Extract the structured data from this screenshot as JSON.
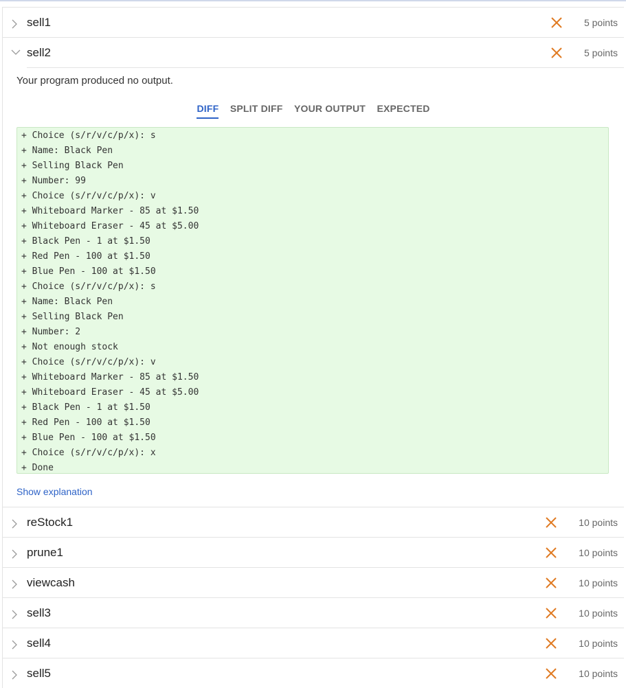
{
  "colors": {
    "fail_x": "#e07a22",
    "accent": "#2e63c7",
    "diff_bg": "#e7fae4"
  },
  "collapsed_top": [
    {
      "name": "sell1",
      "points": "5 points"
    }
  ],
  "expanded": {
    "name": "sell2",
    "points": "5 points",
    "message": "Your program produced no output.",
    "tabs": [
      "DIFF",
      "SPLIT DIFF",
      "YOUR OUTPUT",
      "EXPECTED"
    ],
    "active_tab": "DIFF",
    "diff_lines": [
      "+ Choice (s/r/v/c/p/x): s",
      "+ Name: Black Pen",
      "+ Selling Black Pen",
      "+ Number: 99",
      "+ Choice (s/r/v/c/p/x): v",
      "+ Whiteboard Marker - 85 at $1.50",
      "+ Whiteboard Eraser - 45 at $5.00",
      "+ Black Pen - 1 at $1.50",
      "+ Red Pen - 100 at $1.50",
      "+ Blue Pen - 100 at $1.50",
      "+ Choice (s/r/v/c/p/x): s",
      "+ Name: Black Pen",
      "+ Selling Black Pen",
      "+ Number: 2",
      "+ Not enough stock",
      "+ Choice (s/r/v/c/p/x): v",
      "+ Whiteboard Marker - 85 at $1.50",
      "+ Whiteboard Eraser - 45 at $5.00",
      "+ Black Pen - 1 at $1.50",
      "+ Red Pen - 100 at $1.50",
      "+ Blue Pen - 100 at $1.50",
      "+ Choice (s/r/v/c/p/x): x",
      "+ Done"
    ],
    "show_explanation": "Show explanation"
  },
  "collapsed_bottom": [
    {
      "name": "reStock1",
      "points": "10 points"
    },
    {
      "name": "prune1",
      "points": "10 points"
    },
    {
      "name": "viewcash",
      "points": "10 points"
    },
    {
      "name": "sell3",
      "points": "10 points"
    },
    {
      "name": "sell4",
      "points": "10 points"
    },
    {
      "name": "sell5",
      "points": "10 points"
    }
  ]
}
